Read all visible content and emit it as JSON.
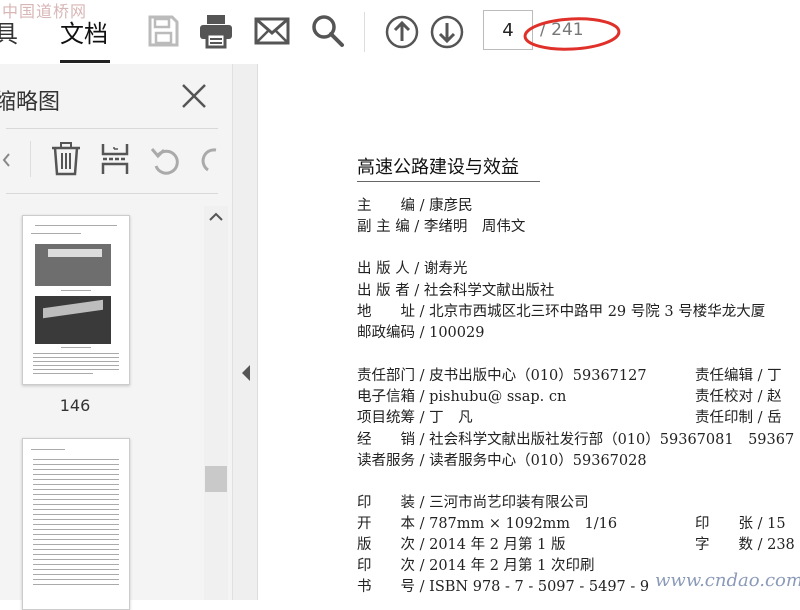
{
  "watermark_top": "中国道桥网",
  "watermark_bottom": "www.cndao.com",
  "toolbar": {
    "tabs": [
      {
        "label": "具"
      },
      {
        "label": "文档"
      }
    ],
    "page_current": "4",
    "page_total": "/ 241"
  },
  "panel": {
    "title": "缩略图",
    "thumbnails": [
      {
        "label": "146"
      }
    ]
  },
  "document": {
    "title": "高速公路建设与效益",
    "lines": [
      "主　　编 / 康彦民",
      "副 主 编 / 李绪明　周伟文",
      "出 版 人 / 谢寿光",
      "出 版 者 / 社会科学文献出版社",
      "地　　址 / 北京市西城区北三环中路甲 29 号院 3 号楼华龙大厦",
      "邮政编码 / 100029",
      "责任部门 / 皮书出版中心（010）59367127",
      "电子信箱 / pishubu@ ssap. cn",
      "项目统筹 / 丁　凡",
      "经　　销 / 社会科学文献出版社发行部（010）59367081　59367",
      "读者服务 / 读者服务中心（010）59367028",
      "印　　装 / 三河市尚艺印装有限公司",
      "开　　本 / 787mm × 1092mm　1/16",
      "版　　次 / 2014 年 2 月第 1 版",
      "印　　次 / 2014 年 2 月第 1 次印刷",
      "书　　号 / ISBN 978 - 7 - 5097 - 5497 - 9"
    ],
    "right_lines": [
      "责任编辑 / 丁",
      "责任校对 / 赵",
      "责任印制 / 岳",
      "印　　张 / 15",
      "字　　数 / 238"
    ]
  },
  "colors": {
    "annotation_circle": "#e0302a",
    "icon": "#555555",
    "icon_disabled": "#bbbbbb"
  }
}
